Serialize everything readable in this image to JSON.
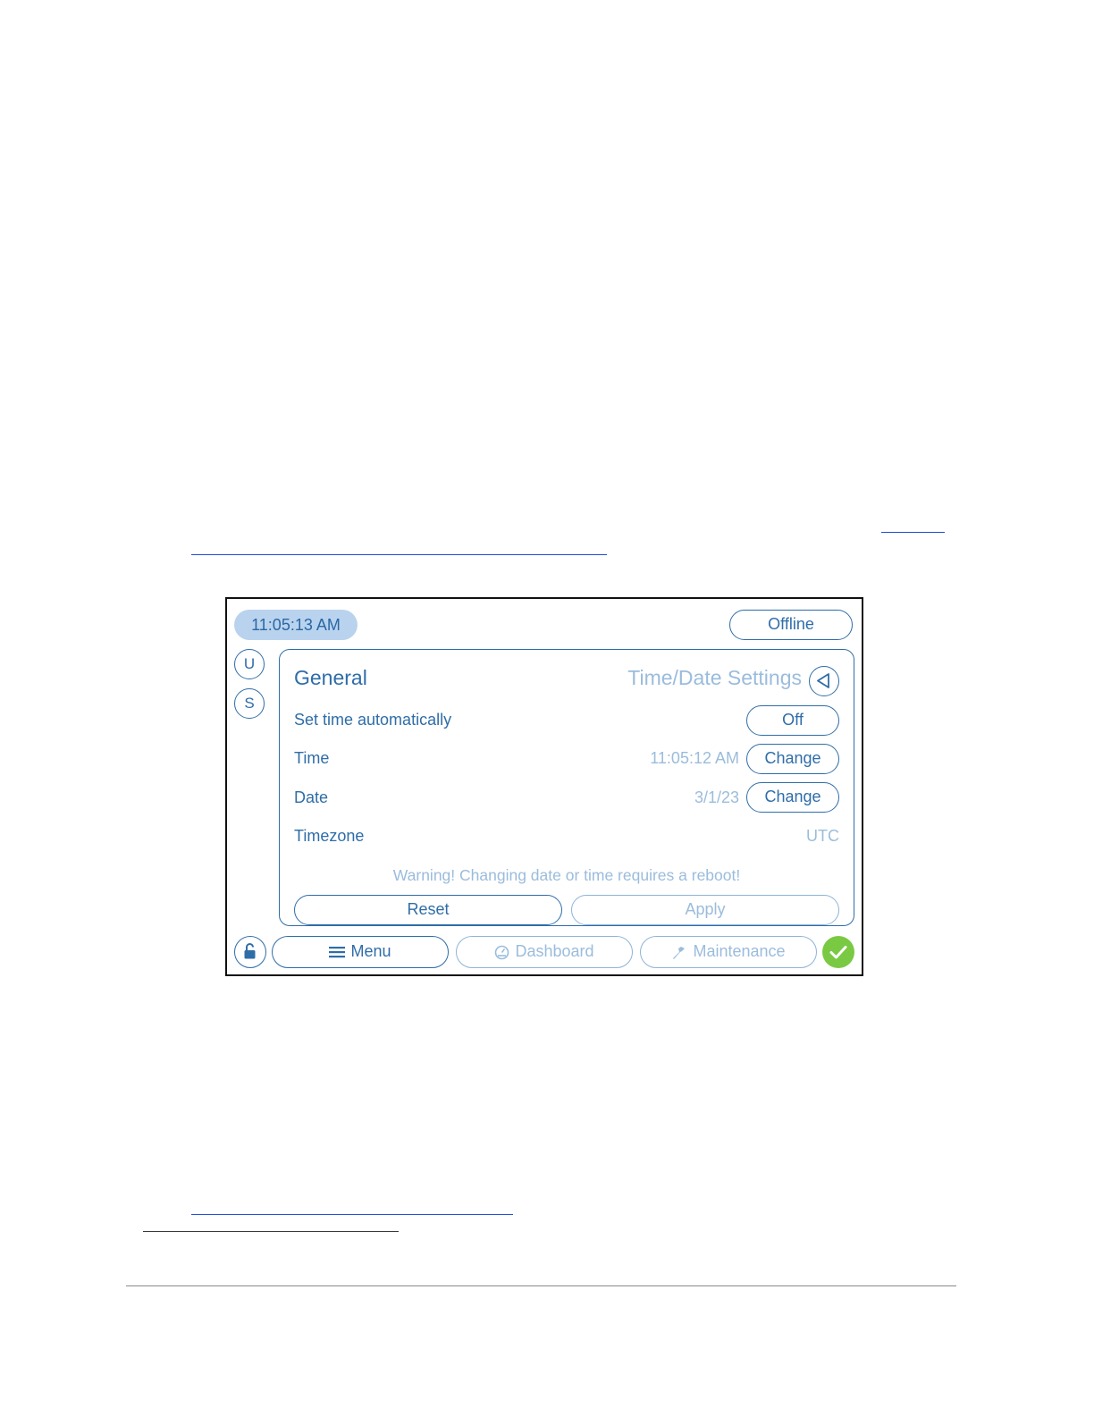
{
  "screen": {
    "clock": "11:05:13 AM",
    "status_button": "Offline",
    "side": {
      "user_label": "U",
      "settings_label": "S"
    },
    "panel": {
      "title": "General",
      "subtitle": "Time/Date Settings",
      "rows": [
        {
          "label": "Set time automatically",
          "value": "",
          "button": "Off"
        },
        {
          "label": "Time",
          "value": "11:05:12 AM",
          "button": "Change"
        },
        {
          "label": "Date",
          "value": "3/1/23",
          "button": "Change"
        },
        {
          "label": "Timezone",
          "value": "UTC",
          "button": ""
        }
      ],
      "warning": "Warning! Changing date or time requires a reboot!",
      "reset_button": "Reset",
      "apply_button": "Apply"
    },
    "bottom_bar": {
      "menu": "Menu",
      "dashboard": "Dashboard",
      "maintenance": "Maintenance"
    },
    "colors": {
      "primary": "#2f6da8",
      "muted": "#9bbcdc",
      "clock_bg": "#b9d3ee",
      "ok_green": "#7ac943"
    },
    "icons": [
      "back-arrow-icon",
      "unlock-icon",
      "hamburger-menu-icon",
      "dashboard-icon",
      "maintenance-icon",
      "check-icon"
    ]
  }
}
